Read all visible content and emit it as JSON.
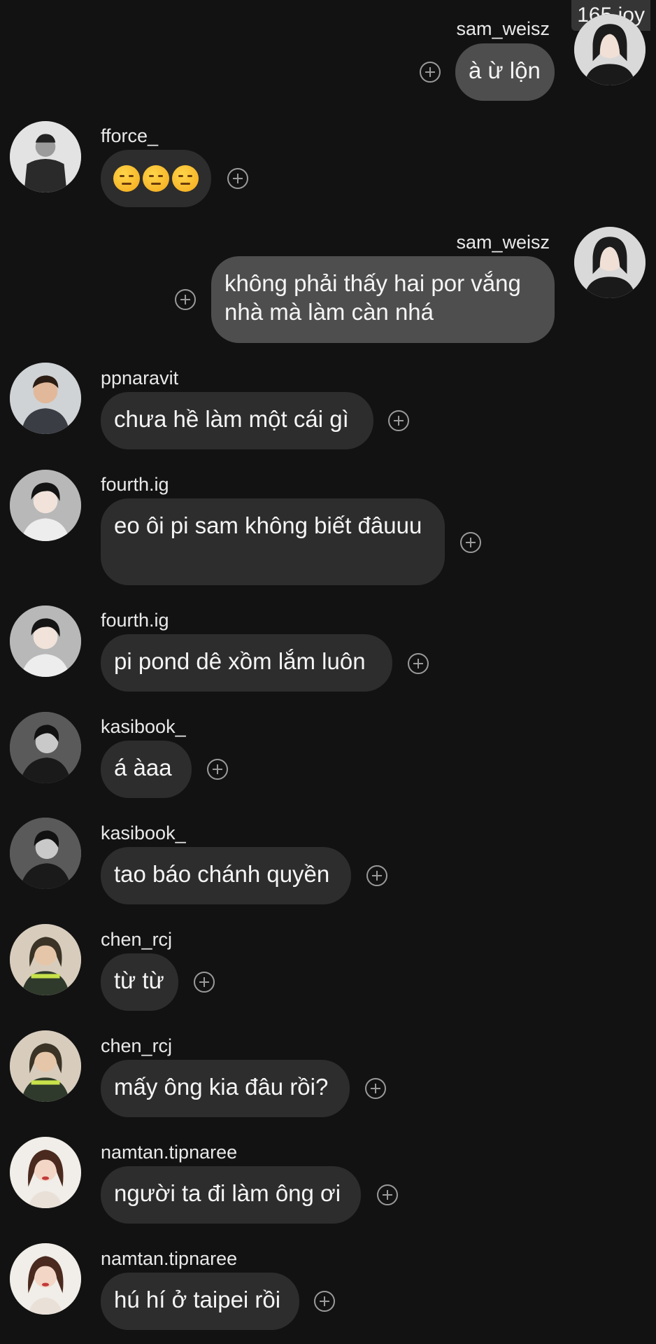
{
  "watermark": "165 joy",
  "messages": [
    {
      "user": "sam_weisz",
      "text": "à ừ lộn",
      "side": "right"
    },
    {
      "user": "fforce_",
      "text": "😒😒😒",
      "side": "left"
    },
    {
      "user": "sam_weisz",
      "text": "không phải thấy hai por vắng nhà mà làm càn nhá",
      "side": "right"
    },
    {
      "user": "ppnaravit",
      "text": "chưa hề làm một cái gì",
      "side": "left"
    },
    {
      "user": "fourth.ig",
      "text": "eo ôi pi sam không biết đâuuu",
      "side": "left"
    },
    {
      "user": "fourth.ig",
      "text": "pi pond dê xồm lắm luôn",
      "side": "left"
    },
    {
      "user": "kasibook_",
      "text": "á àaa",
      "side": "left"
    },
    {
      "user": "kasibook_",
      "text": "tao báo chánh quyền",
      "side": "left"
    },
    {
      "user": "chen_rcj",
      "text": "từ từ",
      "side": "left"
    },
    {
      "user": "chen_rcj",
      "text": "mấy ông kia đâu rồi?",
      "side": "left"
    },
    {
      "user": "namtan.tipnaree",
      "text": "người ta đi làm ông ơi",
      "side": "left"
    },
    {
      "user": "namtan.tipnaree",
      "text": "hú hí ở taipei rồi",
      "side": "left"
    }
  ],
  "icons": {
    "react": "add-reaction-icon",
    "avatar": "profile-photo"
  }
}
